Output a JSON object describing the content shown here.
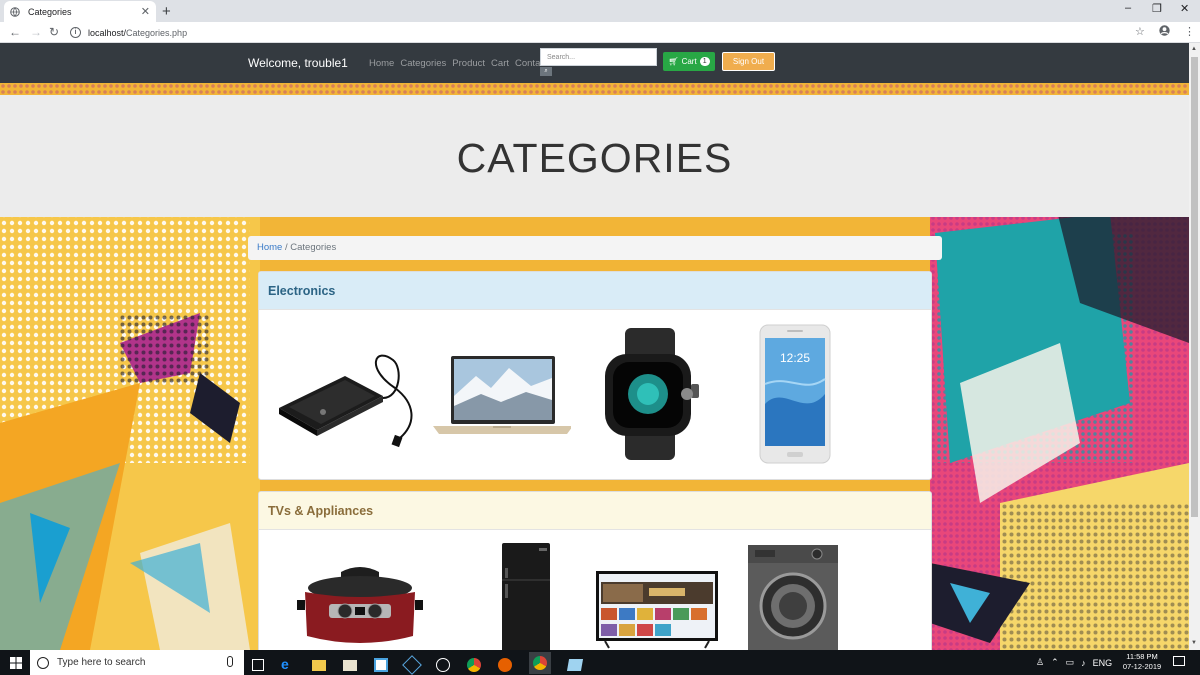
{
  "browser": {
    "tab_title": "Categories",
    "new_tab": "+",
    "url_host": "localhost/",
    "url_path": "Categories.php",
    "window_controls": [
      "–",
      "❐",
      "✕"
    ]
  },
  "site": {
    "brand": "Welcome, trouble1",
    "nav_links": [
      "Home",
      "Categories",
      "Product",
      "Cart",
      "Contact"
    ],
    "search_placeholder": "Search...",
    "cart_label": "Cart",
    "cart_count": "1",
    "signout_label": "Sign Out"
  },
  "page": {
    "heading": "CATEGORIES",
    "breadcrumb_home": "Home",
    "breadcrumb_sep": "/",
    "breadcrumb_current": "Categories"
  },
  "categories": [
    {
      "title": "Electronics",
      "header_bg": "#d9ecf7",
      "title_color": "#2c6485",
      "products": [
        "external-hard-drive",
        "laptop",
        "smartwatch",
        "smartphone"
      ]
    },
    {
      "title": "TVs & Appliances",
      "header_bg": "#fcf8e3",
      "title_color": "#8a6d3b",
      "products": [
        "slow-cooker",
        "refrigerator",
        "television",
        "washing-machine"
      ]
    }
  ],
  "taskbar": {
    "search_placeholder": "Type here to search",
    "language": "ENG",
    "time": "11:58 PM",
    "date": "07-12-2019"
  }
}
